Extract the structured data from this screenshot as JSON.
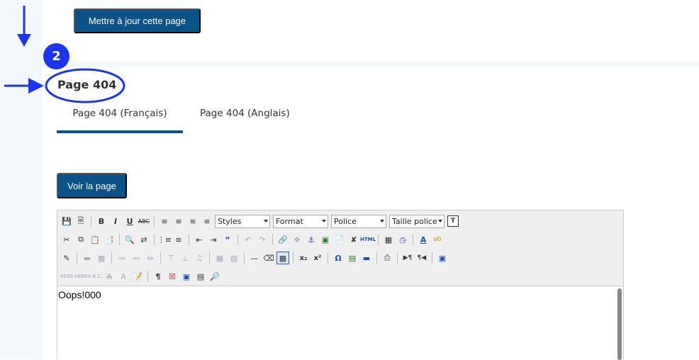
{
  "header": {
    "update_button": "Mettre à jour cette page"
  },
  "annotation": {
    "step_number": "2"
  },
  "section": {
    "title": "Page 404"
  },
  "tabs": [
    {
      "label": "Page 404 (Français)",
      "active": true
    },
    {
      "label": "Page 404 (Anglais)",
      "active": false
    }
  ],
  "actions": {
    "view_page": "Voir la page"
  },
  "editor": {
    "combos": {
      "styles": "Styles",
      "format": "Format",
      "font": "Police",
      "size": "Taille police"
    },
    "content": "Oops!000"
  },
  "colors": {
    "primary": "#0b5287",
    "annotation": "#1b35ee",
    "rail": "#f3f8fd"
  }
}
